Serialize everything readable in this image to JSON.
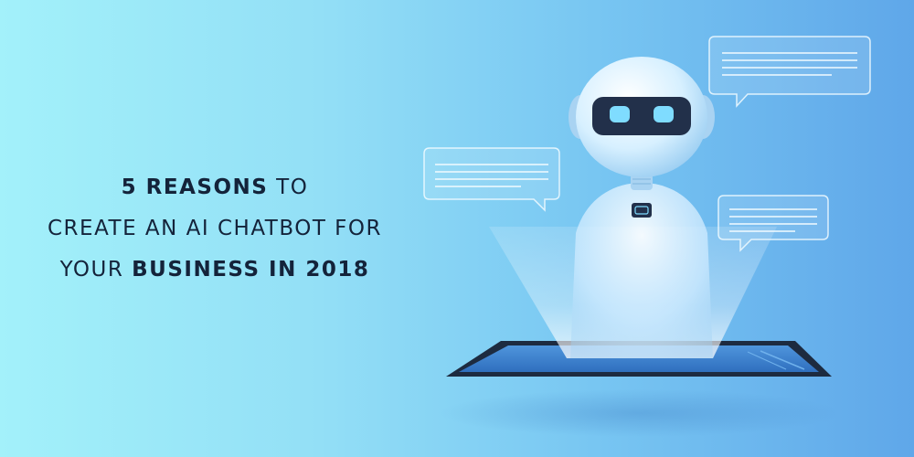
{
  "headline": {
    "line1_bold": "5 REASONS",
    "line1_rest": " TO",
    "line2": "CREATE AN AI CHATBOT FOR",
    "line3_start": "YOUR ",
    "line3_bold": "BUSINESS IN 2018"
  },
  "illustration": {
    "subject": "robot-hologram",
    "icons": [
      "robot-icon",
      "chat-bubble-icon",
      "tablet-icon"
    ]
  },
  "colors": {
    "background_left": "#a3f1fa",
    "background_right": "#5fa7e9",
    "text": "#14233a",
    "tablet_frame": "#1d2b40",
    "visor": "#22304a",
    "robot_eyes": "#7fdcff"
  }
}
